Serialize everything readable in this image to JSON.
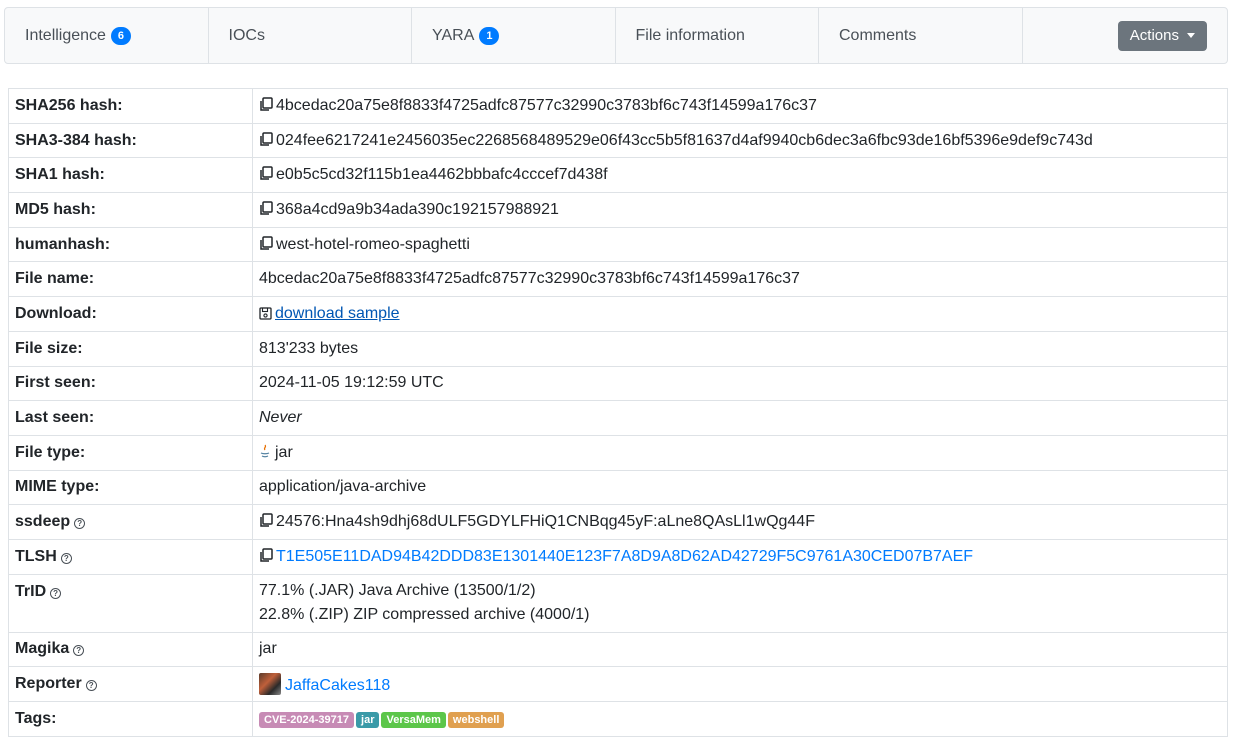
{
  "tabs": [
    {
      "label": "Intelligence",
      "badge": "6"
    },
    {
      "label": "IOCs"
    },
    {
      "label": "YARA",
      "badge": "1"
    },
    {
      "label": "File information"
    },
    {
      "label": "Comments"
    }
  ],
  "actions_label": "Actions",
  "rows": {
    "sha256": {
      "key": "SHA256 hash:",
      "value": "4bcedac20a75e8f8833f4725adfc87577c32990c3783bf6c743f14599a176c37"
    },
    "sha3": {
      "key": "SHA3-384 hash:",
      "value": "024fee6217241e2456035ec2268568489529e06f43cc5b5f81637d4af9940cb6dec3a6fbc93de16bf5396e9def9c743d"
    },
    "sha1": {
      "key": "SHA1 hash:",
      "value": "e0b5c5cd32f115b1ea4462bbbafc4cccef7d438f"
    },
    "md5": {
      "key": "MD5 hash:",
      "value": "368a4cd9a9b34ada390c192157988921"
    },
    "humanhash": {
      "key": "humanhash:",
      "value": "west-hotel-romeo-spaghetti"
    },
    "filename": {
      "key": "File name:",
      "value": "4bcedac20a75e8f8833f4725adfc87577c32990c3783bf6c743f14599a176c37"
    },
    "download": {
      "key": "Download:",
      "value": "download sample"
    },
    "filesize": {
      "key": "File size:",
      "value": "813'233 bytes"
    },
    "firstseen": {
      "key": "First seen:",
      "value": "2024-11-05 19:12:59 UTC"
    },
    "lastseen": {
      "key": "Last seen:",
      "value": "Never"
    },
    "filetype": {
      "key": "File type:",
      "value": "jar"
    },
    "mime": {
      "key": "MIME type:",
      "value": "application/java-archive"
    },
    "ssdeep": {
      "key": "ssdeep",
      "value": "24576:Hna4sh9dhj68dULF5GDYLFHiQ1CNBqg45yF:aLne8QAsLl1wQg44F"
    },
    "tlsh": {
      "key": "TLSH",
      "value": "T1E505E11DAD94B42DDD83E1301440E123F7A8D9A8D62AD42729F5C9761A30CED07B7AEF"
    },
    "trid": {
      "key": "TrID",
      "line1": "77.1% (.JAR) Java Archive (13500/1/2)",
      "line2": "22.8% (.ZIP) ZIP compressed archive (4000/1)"
    },
    "magika": {
      "key": "Magika",
      "value": "jar"
    },
    "reporter": {
      "key": "Reporter",
      "value": "JaffaCakes118"
    },
    "tags": {
      "key": "Tags:",
      "items": [
        {
          "label": "CVE-2024-39717",
          "color": "#c78bb5"
        },
        {
          "label": "jar",
          "color": "#3a9aa8"
        },
        {
          "label": "VersaMem",
          "color": "#5cc64a"
        },
        {
          "label": "webshell",
          "color": "#e0a050"
        }
      ]
    }
  }
}
